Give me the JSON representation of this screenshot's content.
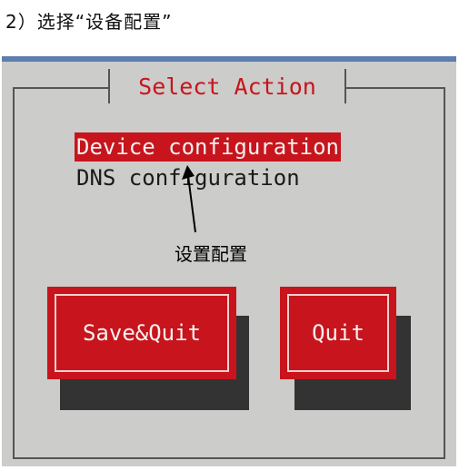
{
  "caption": "2）选择“设备配置”",
  "dialog": {
    "title": "Select Action",
    "menu": [
      {
        "label": "Device configuration",
        "selected": true
      },
      {
        "label": "DNS configuration",
        "selected": false
      }
    ]
  },
  "annotation": {
    "text": "设置配置",
    "arrow_icon": "arrow-up"
  },
  "buttons": {
    "save_quit": "Save&Quit",
    "quit": "Quit"
  },
  "colors": {
    "accent_red": "#c8141c",
    "screen_bg": "#ccccca",
    "top_bar_blue": "#5c7fb0",
    "button_shadow": "#333333"
  }
}
